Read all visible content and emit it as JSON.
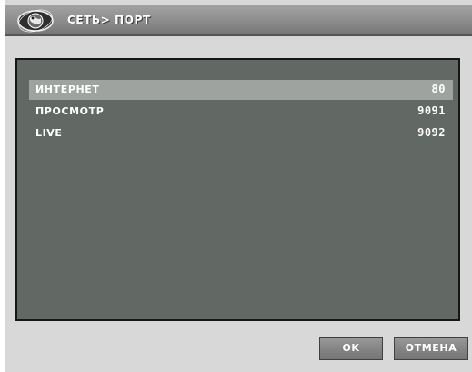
{
  "title": "СЕТЬ> ПОРТ",
  "logo_icon": "globe-logo-icon",
  "ports": [
    {
      "label": "ИНТЕРНЕТ",
      "value": "80",
      "selected": true
    },
    {
      "label": "ПРОСМОТР",
      "value": "9091",
      "selected": false
    },
    {
      "label": "LIVE",
      "value": "9092",
      "selected": false
    }
  ],
  "buttons": {
    "ok_label": "OK",
    "cancel_label": "ОТМЕНА"
  },
  "colors": {
    "panel_background": "#626965",
    "selected_row": "#9ea39f",
    "titlebar": "#8c8c8c",
    "text": "#ffffff"
  }
}
